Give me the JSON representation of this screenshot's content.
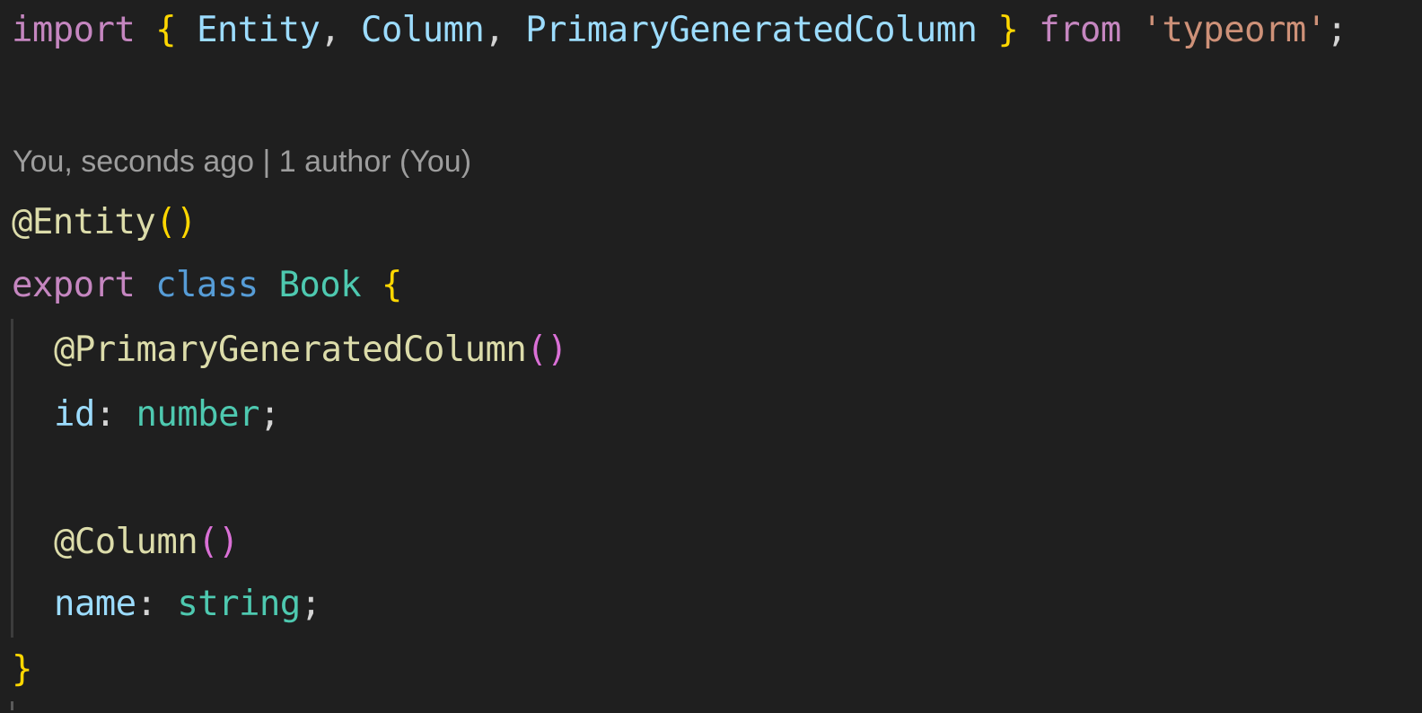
{
  "colors": {
    "background": "#1f1f1f",
    "codelens": "#9d9d9d",
    "keyword_purple": "#c586c0",
    "keyword_blue": "#569cd6",
    "identifier": "#9cdcfe",
    "type": "#4ec9b0",
    "decorator": "#dcdcaa",
    "string": "#ce9178",
    "plain": "#d4d4d4",
    "brace_gold": "#ffd700",
    "brace_purple": "#da70d6"
  },
  "code": {
    "line1": {
      "import_kw": "import",
      "open_brace": "{",
      "entity": "Entity",
      "comma1": ",",
      "column": "Column",
      "comma2": ",",
      "primary_generated_column": "PrimaryGeneratedColumn",
      "close_brace": "}",
      "from_kw": "from",
      "module": "'typeorm'",
      "semicolon": ";"
    },
    "codelens": "You, seconds ago | 1 author (You)",
    "line_entity": {
      "decorator": "@Entity",
      "parens": "()"
    },
    "line_class": {
      "export_kw": "export",
      "class_kw": "class",
      "class_name": "Book",
      "open_brace": "{"
    },
    "line_primary_decorator": {
      "decorator": "@PrimaryGeneratedColumn",
      "parens": "()"
    },
    "line_id": {
      "name": "id",
      "colon": ":",
      "type": "number",
      "semicolon": ";"
    },
    "line_column_decorator": {
      "decorator": "@Column",
      "parens": "()"
    },
    "line_name": {
      "name": "name",
      "colon": ":",
      "type": "string",
      "semicolon": ";"
    },
    "line_close": {
      "brace": "}"
    }
  }
}
